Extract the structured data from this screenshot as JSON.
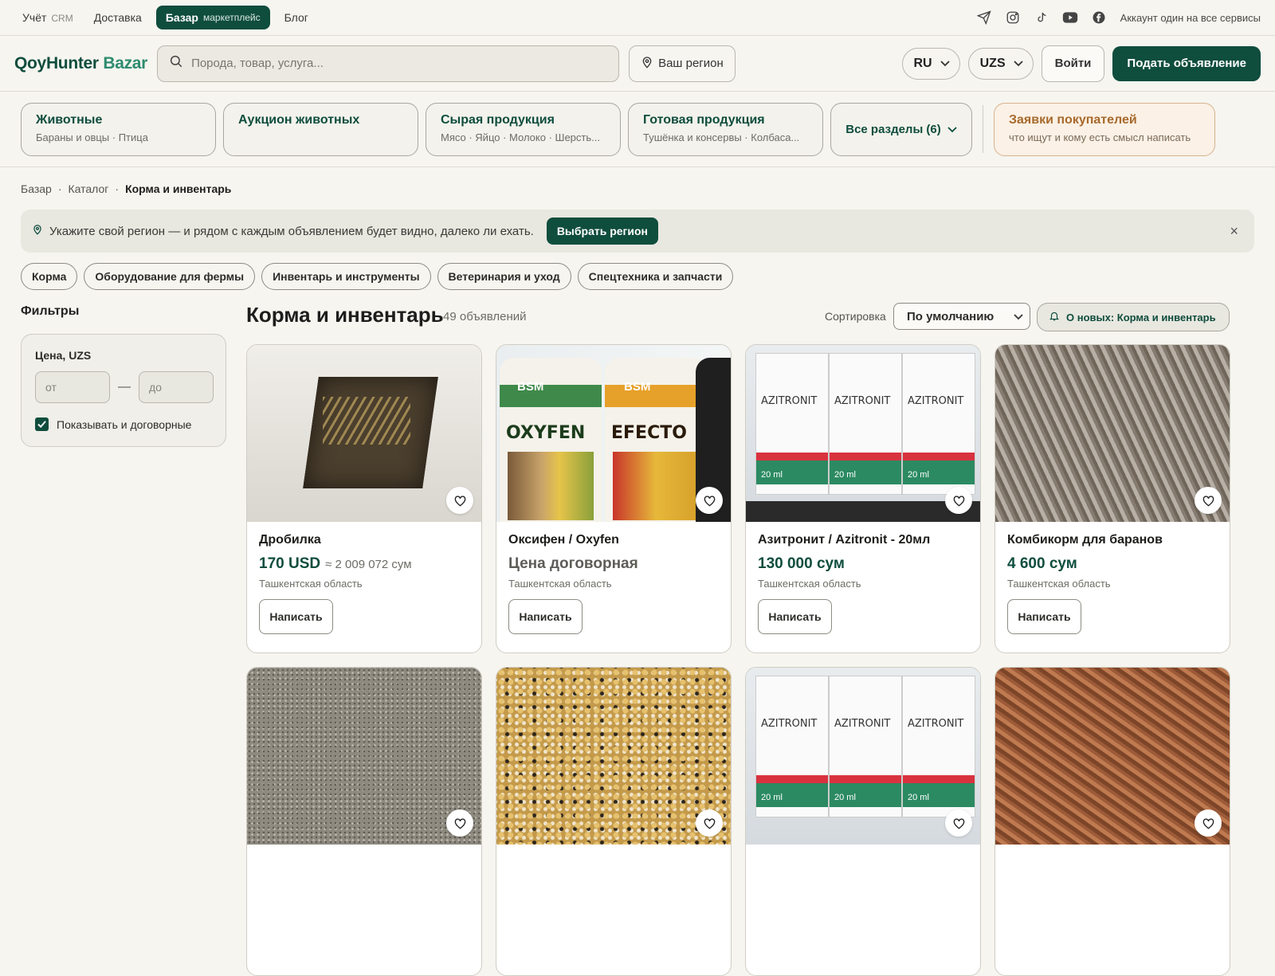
{
  "topbar": {
    "links": [
      {
        "label": "Учёт",
        "sub": "CRM"
      },
      {
        "label": "Доставка",
        "sub": ""
      }
    ],
    "active": {
      "label": "Базар",
      "sub": "маркетплейс"
    },
    "blog": "Блог",
    "account_text": "Аккаунт один на все сервисы",
    "social_icons": [
      "telegram-icon",
      "instagram-icon",
      "tiktok-icon",
      "youtube-icon",
      "facebook-icon"
    ]
  },
  "header": {
    "logo_main": "QoyHunter",
    "logo_accent": "Bazar",
    "search_placeholder": "Порода, товар, услуга...",
    "region_label": "Ваш регион",
    "lang": "RU",
    "currency": "UZS",
    "login_label": "Войти",
    "cta_label": "Подать объявление"
  },
  "categories": [
    {
      "title": "Животные",
      "sub": "Бараны и овцы · Птица"
    },
    {
      "title": "Аукцион животных",
      "sub": ""
    },
    {
      "title": "Сырая продукция",
      "sub": "Мясо · Яйцо · Молоко · Шерсть..."
    },
    {
      "title": "Готовая продукция",
      "sub": "Тушёнка и консервы · Колбаса..."
    }
  ],
  "all_sections_label": "Все разделы (6)",
  "requests": {
    "title": "Заявки покупателей",
    "sub": "что ищут и кому есть смысл написать"
  },
  "breadcrumb": [
    "Базар",
    "Каталог",
    "Корма и инвентарь"
  ],
  "banner": {
    "text": "Укажите свой регион — и рядом с каждым объявлением будет видно, далеко ли ехать.",
    "button": "Выбрать регион",
    "close": "×"
  },
  "chips": [
    "Корма",
    "Оборудование для фермы",
    "Инвентарь и инструменты",
    "Ветеринария и уход",
    "Спецтехника и запчасти"
  ],
  "filters": {
    "title": "Фильтры",
    "price_label": "Цена, UZS",
    "from_placeholder": "от",
    "to_placeholder": "до",
    "dash": "—",
    "negotiable_label": "Показывать и договорные",
    "negotiable_checked": true
  },
  "listing": {
    "title": "Корма и инвентарь",
    "count": "49 объявлений",
    "sort_label": "Сортировка",
    "sort_value": "По умолчанию",
    "subscribe_label": "О новых: Корма и инвентарь"
  },
  "cards": [
    {
      "title": "Дробилка",
      "price": "170 USD",
      "converted": "≈ 2 009 072 сум",
      "location": "Ташкентская область",
      "button": "Написать",
      "image": "crusher-photo"
    },
    {
      "title": "Оксифен / Oxyfen",
      "price": "Цена договорная",
      "converted": "",
      "location": "Ташкентская область",
      "button": "Написать",
      "image": "bottles-photo",
      "negotiable": true
    },
    {
      "title": "Азитронит / Azitronit - 20мл",
      "price": "130 000 сум",
      "converted": "",
      "location": "Ташкентская область",
      "button": "Написать",
      "image": "azitronit-photo"
    },
    {
      "title": "Комбикорм для баранов",
      "price": "4 600 сум",
      "converted": "",
      "location": "Ташкентская область",
      "button": "Написать",
      "image": "pellets-photo"
    },
    {
      "title": "",
      "price": "",
      "converted": "",
      "location": "",
      "button": "",
      "image": "gravel-photo"
    },
    {
      "title": "",
      "price": "",
      "converted": "",
      "location": "",
      "button": "",
      "image": "grain-photo"
    },
    {
      "title": "",
      "price": "",
      "converted": "",
      "location": "",
      "button": "",
      "image": "azitronit-photo"
    },
    {
      "title": "",
      "price": "",
      "converted": "",
      "location": "",
      "button": "",
      "image": "pellets-brown-photo"
    }
  ],
  "image_text": {
    "bottle1_brand": "BSM",
    "bottle1_name": "OXYFEN",
    "bottle2_brand": "BSM",
    "bottle2_name": "EFECTO",
    "box_name": "AZITRONIT",
    "box_volume": "20 ml"
  },
  "colors": {
    "brand": "#0f4d3d",
    "accent": "#2e8b6f",
    "request": "#a86a2c"
  }
}
